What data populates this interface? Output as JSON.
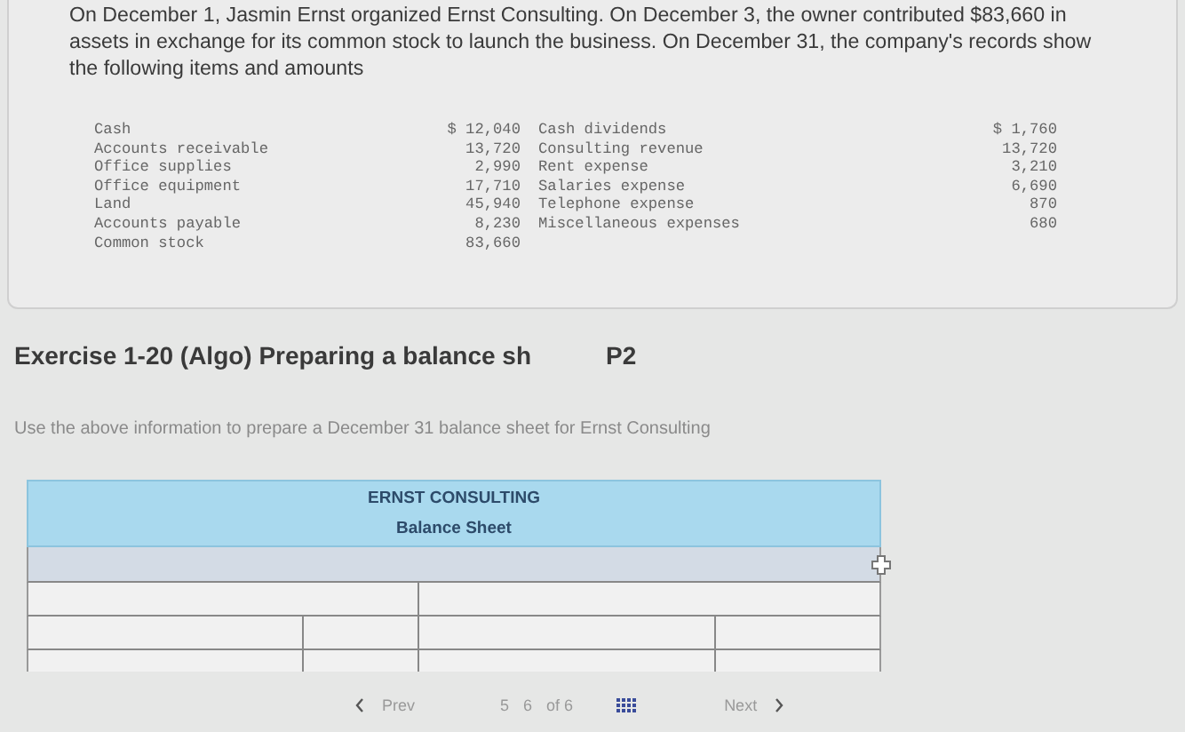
{
  "problem": {
    "intro": "On December 1, Jasmin Ernst organized Ernst Consulting. On December 3, the owner contributed $83,660 in assets in exchange for its common stock to launch the business. On December 31, the company's records show the following items and amounts",
    "items_left": [
      {
        "label": "Cash",
        "amount": "$ 12,040"
      },
      {
        "label": "Accounts receivable",
        "amount": "13,720"
      },
      {
        "label": "Office supplies",
        "amount": "2,990"
      },
      {
        "label": "Office equipment",
        "amount": "17,710"
      },
      {
        "label": "Land",
        "amount": "45,940"
      },
      {
        "label": "Accounts payable",
        "amount": "8,230"
      },
      {
        "label": "Common stock",
        "amount": "83,660"
      }
    ],
    "items_right": [
      {
        "label": "Cash dividends",
        "amount": "$ 1,760"
      },
      {
        "label": "Consulting revenue",
        "amount": "13,720"
      },
      {
        "label": "Rent expense",
        "amount": "3,210"
      },
      {
        "label": "Salaries expense",
        "amount": "6,690"
      },
      {
        "label": "Telephone expense",
        "amount": "870"
      },
      {
        "label": "Miscellaneous expenses",
        "amount": "680"
      }
    ]
  },
  "exercise": {
    "title": "Exercise 1-20 (Algo) Preparing a balance sh",
    "code": "P2"
  },
  "instruction": "Use the above information to prepare a December 31 balance sheet for Ernst Consulting",
  "balance_sheet": {
    "company": "ERNST CONSULTING",
    "title": "Balance Sheet",
    "rows": [
      {
        "kind": "date"
      },
      {
        "kind": "two"
      },
      {
        "kind": "four"
      },
      {
        "kind": "four"
      }
    ]
  },
  "nav": {
    "prev": "Prev",
    "pages": [
      "5",
      "6"
    ],
    "of": "of 6",
    "next": "Next"
  }
}
